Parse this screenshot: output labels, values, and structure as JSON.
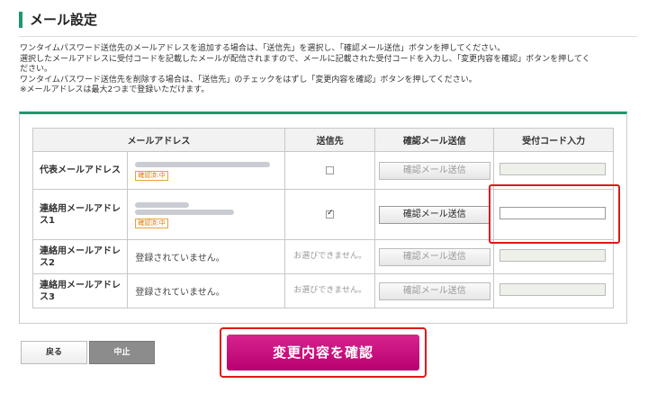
{
  "header": {
    "title": "メール設定"
  },
  "description": [
    "ワンタイムパスワード送信先のメールアドレスを追加する場合は、「送信先」を選択し、「確認メール送信」ボタンを押してください。",
    "選択したメールアドレスに受付コードを記載したメールが配信されますので、メールに記載された受付コードを入力し、「変更内容を確認」ボタンを押してく",
    "ださい。",
    "ワンタイムパスワード送信先を削除する場合は、「送信先」のチェックをはずし「変更内容を確認」ボタンを押してください。",
    "※メールアドレスは最大2つまで登録いただけます。"
  ],
  "table": {
    "headers": [
      "メールアドレス",
      "送信先",
      "確認メール送信",
      "受付コード入力"
    ],
    "rows": [
      {
        "label": "代表メールアドレス",
        "email_text": "",
        "badge": "確認済:中",
        "checked": false,
        "not_selectable": "",
        "send_label": "確認メール送信",
        "send_active": false
      },
      {
        "label": "連絡用メールアドレス1",
        "email_text": "",
        "badge": "確認済:中",
        "checked": true,
        "not_selectable": "",
        "send_label": "確認メール送信",
        "send_active": true
      },
      {
        "label": "連絡用メールアドレス2",
        "email_text": "登録されていません。",
        "badge": "",
        "checked": false,
        "not_selectable": "お選びできません。",
        "send_label": "確認メール送信",
        "send_active": false
      },
      {
        "label": "連絡用メールアドレス3",
        "email_text": "登録されていません。",
        "badge": "",
        "checked": false,
        "not_selectable": "お選びできません。",
        "send_label": "確認メール送信",
        "send_active": false
      }
    ]
  },
  "buttons": {
    "back": "戻る",
    "stop": "中止",
    "confirm": "変更内容を確認"
  },
  "colors": {
    "accent": "#1a9a6c",
    "confirm": "#c8127f",
    "highlight": "#e01818"
  }
}
